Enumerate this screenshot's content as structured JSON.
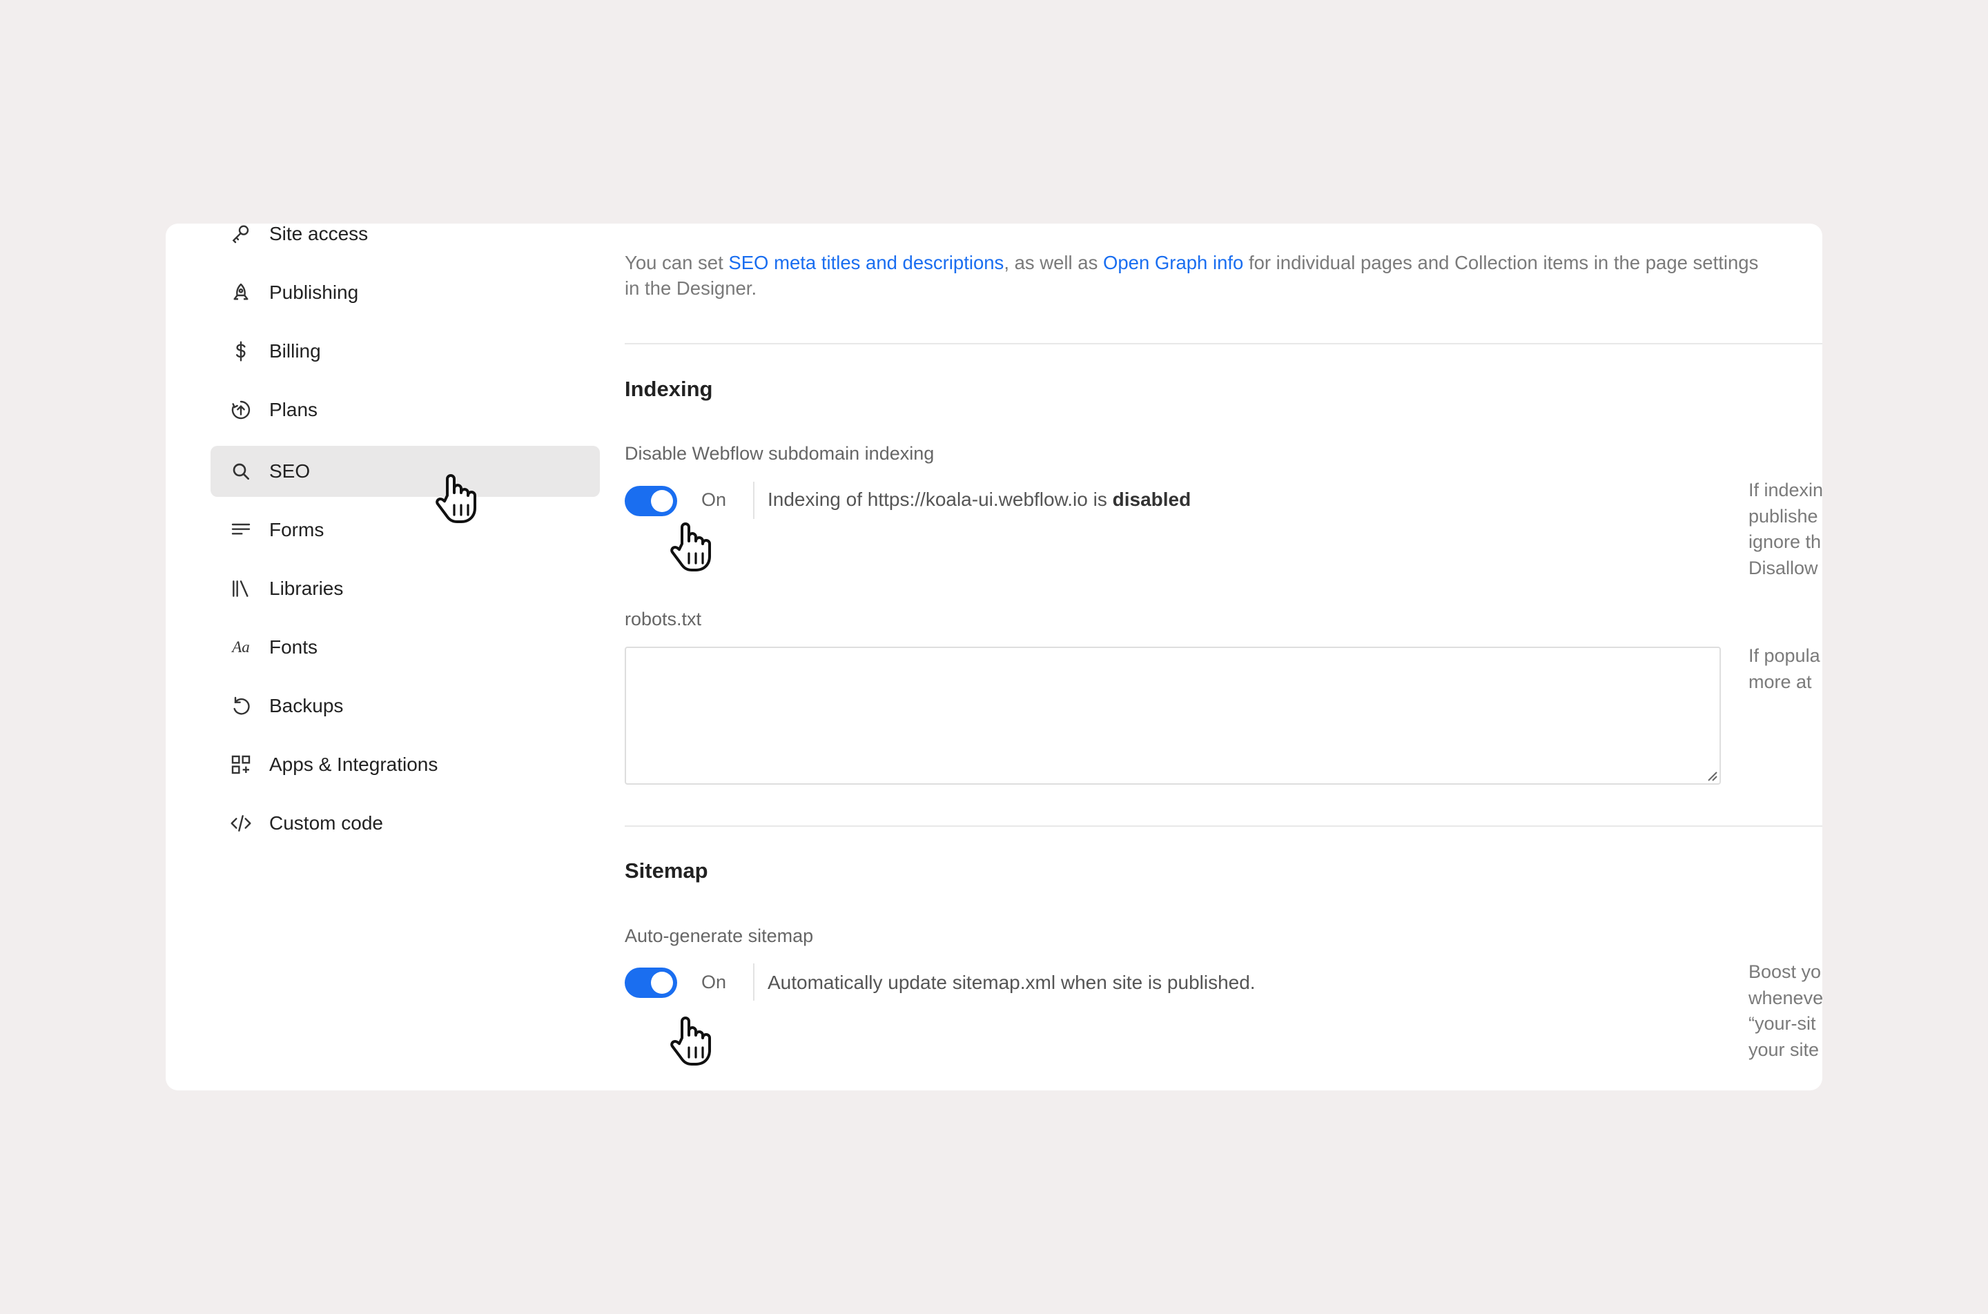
{
  "sidebar": {
    "items": [
      {
        "label": "Site access",
        "icon": "key-icon",
        "active": false
      },
      {
        "label": "Publishing",
        "icon": "rocket-icon",
        "active": false
      },
      {
        "label": "Billing",
        "icon": "dollar-icon",
        "active": false
      },
      {
        "label": "Plans",
        "icon": "plans-icon",
        "active": false
      },
      {
        "label": "SEO",
        "icon": "search-icon",
        "active": true
      },
      {
        "label": "Forms",
        "icon": "forms-icon",
        "active": false
      },
      {
        "label": "Libraries",
        "icon": "libraries-icon",
        "active": false
      },
      {
        "label": "Fonts",
        "icon": "fonts-icon",
        "active": false
      },
      {
        "label": "Backups",
        "icon": "backup-icon",
        "active": false
      },
      {
        "label": "Apps & Integrations",
        "icon": "apps-icon",
        "active": false
      },
      {
        "label": "Custom code",
        "icon": "code-icon",
        "active": false
      }
    ],
    "fonts_icon_text": "Aa"
  },
  "intro": {
    "part1": "You can set ",
    "link1": "SEO meta titles and descriptions",
    "part2": ", as well as ",
    "link2": "Open Graph info",
    "part3": " for individual pages and Collection items in the page settings in the Designer."
  },
  "indexing": {
    "title": "Indexing",
    "field_label": "Disable Webflow subdomain indexing",
    "toggle_state": "On",
    "desc_prefix": "Indexing of https://koala-ui.webflow.io is ",
    "desc_bold": "disabled",
    "help": "If indexin\npublishe\nignore th\nDisallow"
  },
  "robots": {
    "label": "robots.txt",
    "value": "",
    "help": "If popula\nmore at"
  },
  "sitemap": {
    "title": "Sitemap",
    "field_label": "Auto-generate sitemap",
    "toggle_state": "On",
    "desc": "Automatically update sitemap.xml when site is published.",
    "help": "Boost yo\nwheneve\n“your-sit\nyour site"
  },
  "colors": {
    "accent": "#1a6ef0",
    "active_bg": "#e9e8e8",
    "page_bg": "#f2eeee"
  }
}
